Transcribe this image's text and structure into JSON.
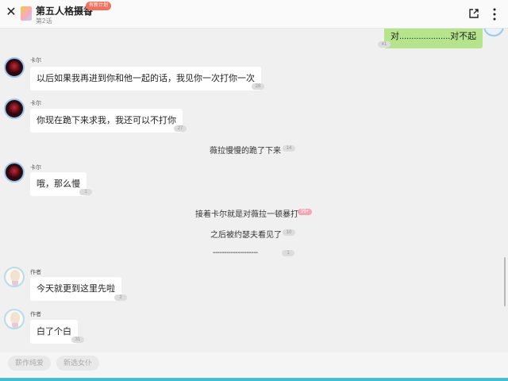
{
  "header": {
    "close_icon": "close-icon",
    "title": "第五人格摄香",
    "chapter": "第2话",
    "update_badge": "有新计划",
    "share_icon": "share-icon",
    "more_icon": "more-icon"
  },
  "messages": [
    {
      "type": "self",
      "text": "对.....................对不起",
      "count": "41"
    },
    {
      "type": "bubble",
      "sender": "卡尔",
      "avatar": "dark",
      "text": "以后如果我再进到你和他一起的话，我见你一次打你一次",
      "count": "28"
    },
    {
      "type": "bubble",
      "sender": "卡尔",
      "avatar": "dark",
      "text": "你现在跪下来求我，我还可以不打你",
      "count": "27"
    },
    {
      "type": "narration",
      "text": "薇拉慢慢的跪了下来",
      "count": "14"
    },
    {
      "type": "bubble",
      "sender": "卡尔",
      "avatar": "dark",
      "text": "哦，那么慢",
      "count": "1"
    },
    {
      "type": "narration",
      "text": "接着卡尔就是对薇拉一顿暴打",
      "count": "99+",
      "hot": true
    },
    {
      "type": "narration",
      "text": "之后被约瑟夫看见了",
      "count": "10"
    },
    {
      "type": "narration",
      "text": "--------------------",
      "count": "1"
    },
    {
      "type": "bubble",
      "sender": "作者",
      "avatar": "light",
      "text": "今天就更到这里先啦",
      "count": "2"
    },
    {
      "type": "bubble",
      "sender": "作者",
      "avatar": "light",
      "text": "白了个白",
      "count": "31"
    }
  ],
  "footer": {
    "tags": [
      "薪作纯爱",
      "新选女仆"
    ]
  }
}
